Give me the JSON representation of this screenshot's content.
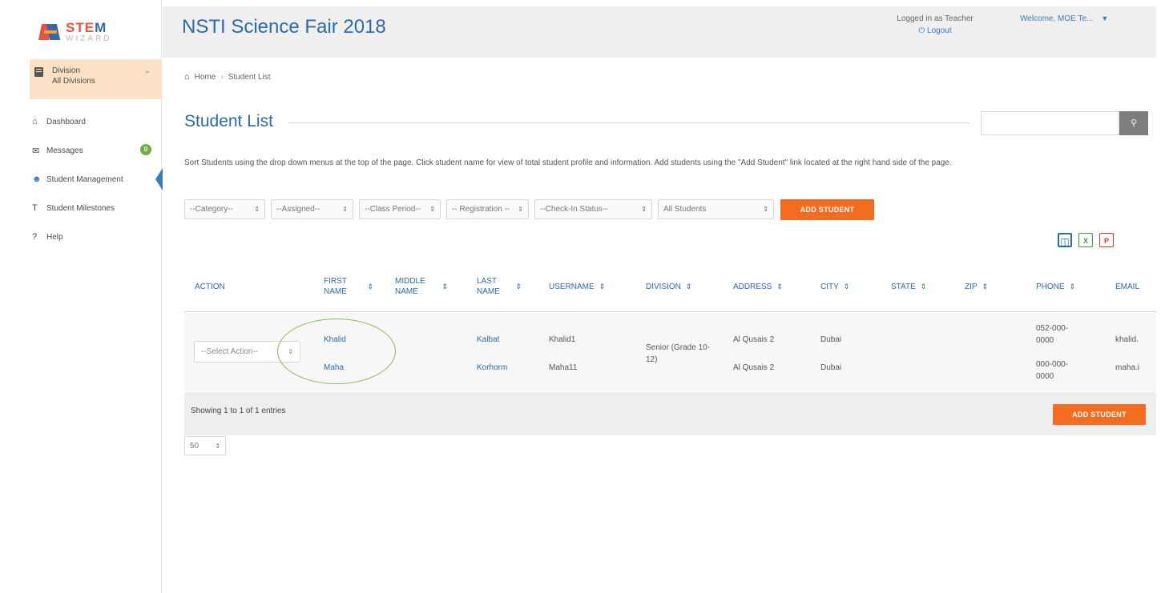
{
  "logo": {
    "line1": "STEM",
    "line2": "WIZARD"
  },
  "sidebar": {
    "division_label": "Division",
    "division_value": "All Divisions",
    "items": [
      {
        "label": "Dashboard",
        "icon": "home-icon"
      },
      {
        "label": "Messages",
        "icon": "envelope-icon",
        "badge": "0"
      },
      {
        "label": "Student Management",
        "icon": "user-icon",
        "active": true
      },
      {
        "label": "Student Milestones",
        "icon": "milestone-icon"
      },
      {
        "label": "Help",
        "icon": "question-icon"
      }
    ]
  },
  "header": {
    "title": "NSTI Science Fair 2018",
    "logged_in": "Logged in as Teacher",
    "logout": "Logout",
    "welcome": "Welcome, MOE Te..."
  },
  "breadcrumb": {
    "home": "Home",
    "current": "Student List"
  },
  "page": {
    "title": "Student List",
    "search_placeholder": "",
    "instructions": "Sort Students using the drop down menus at the top of the page. Click student name for view of total student profile and information. Add students using the \"Add Student\" link located at the right hand side of the page."
  },
  "filters": [
    "--Category--",
    "--Assigned--",
    "--Class Period--",
    "-- Registration --",
    "--Check-In Status--",
    "All Students"
  ],
  "add_student_label": "ADD STUDENT",
  "table": {
    "headers": {
      "action": "ACTION",
      "first_name": "FIRST NAME",
      "middle_name": "MIDDLE NAME",
      "last_name": "LAST NAME",
      "username": "USERNAME",
      "division": "DIVISION",
      "address": "ADDRESS",
      "city": "CITY",
      "state": "STATE",
      "zip": "ZIP",
      "phone": "PHONE",
      "email": "EMAIL"
    },
    "action_select": "--Select Action--",
    "division": "Senior (Grade 10-12)",
    "rows": [
      {
        "first": "Khalid",
        "last": "Kalbat",
        "username": "Khalid1",
        "address": "Al Qusais 2",
        "city": "Dubai",
        "phone": "052-000-0000",
        "email": "khalid."
      },
      {
        "first": "Maha",
        "last": "Korhorm",
        "username": "Maha11",
        "address": "Al Qusais 2",
        "city": "Dubai",
        "phone": "000-000-0000",
        "email": "maha.i"
      }
    ],
    "entries_info": "Showing 1 to 1 of 1 entries",
    "page_size": "50"
  },
  "colors": {
    "brand_blue": "#2d6aa8",
    "accent_orange": "#f26c22",
    "division_bg": "#fbe2c6",
    "highlight_green": "#8fb85a"
  }
}
